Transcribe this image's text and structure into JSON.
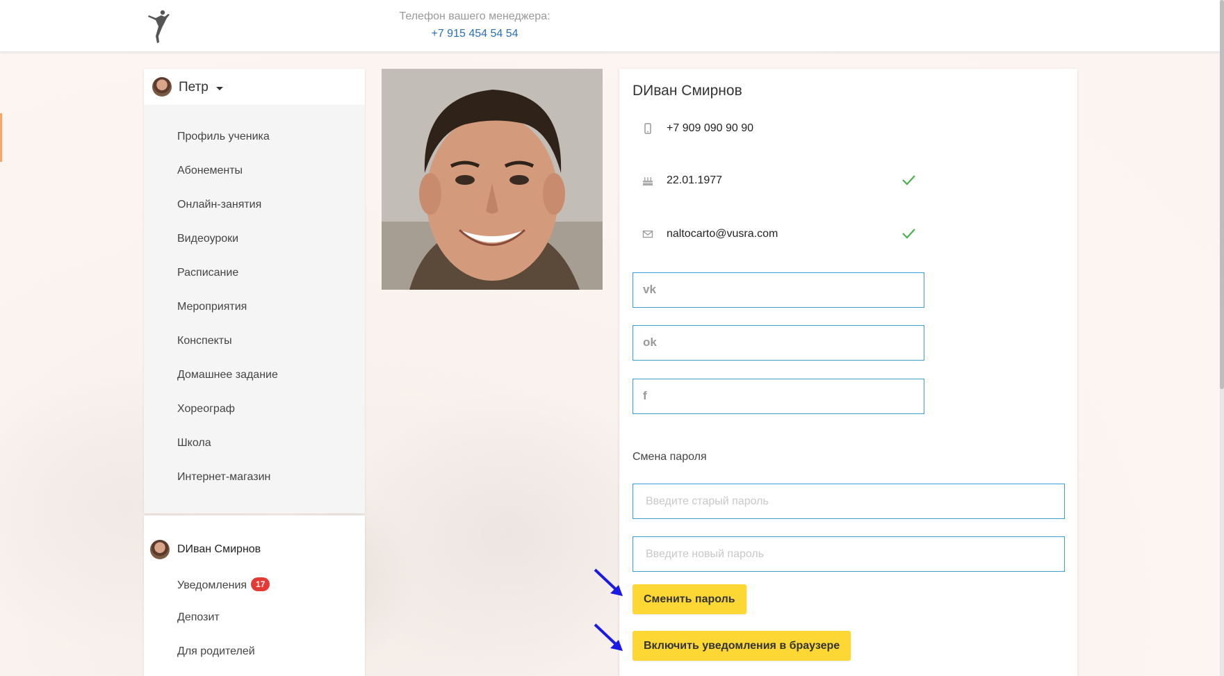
{
  "header": {
    "manager_label": "Телефон вашего менеджера:",
    "manager_phone": "+7 915 454 54 54"
  },
  "sidebar": {
    "user_name": "Петр",
    "menu": [
      {
        "label": "Профиль ученика"
      },
      {
        "label": "Абонементы"
      },
      {
        "label": "Онлайн-занятия"
      },
      {
        "label": "Видеоуроки"
      },
      {
        "label": "Расписание"
      },
      {
        "label": "Мероприятия"
      },
      {
        "label": "Конспекты"
      },
      {
        "label": "Домашнее задание"
      },
      {
        "label": "Хореограф"
      },
      {
        "label": "Школа"
      },
      {
        "label": "Интернет-магазин"
      }
    ],
    "account": {
      "name": "DИван Смирнов",
      "notifications_label": "Уведомления",
      "notifications_count": "17",
      "deposit_label": "Депозит",
      "parents_label": "Для родителей"
    }
  },
  "profile": {
    "name": "DИван Смирнов",
    "phone": "+7 909 090 90 90",
    "birthdate": "22.01.1977",
    "email": "naltocarto@vusra.com",
    "social": {
      "vk_icon": "vk",
      "ok_icon": "ok",
      "fb_icon": "f"
    },
    "password_section": "Смена пароля",
    "old_password_placeholder": "Введите старый пароль",
    "new_password_placeholder": "Введите новый пароль",
    "change_password_button": "Сменить пароль",
    "enable_notifications_button": "Включить уведомления в браузере"
  },
  "colors": {
    "accent_yellow": "#fdd835",
    "link_blue": "#2a6ebb",
    "input_border": "#3a9fd8",
    "check_green": "#4caf50",
    "badge_red": "#e53935",
    "annotation_arrow": "#1a1ae6"
  }
}
